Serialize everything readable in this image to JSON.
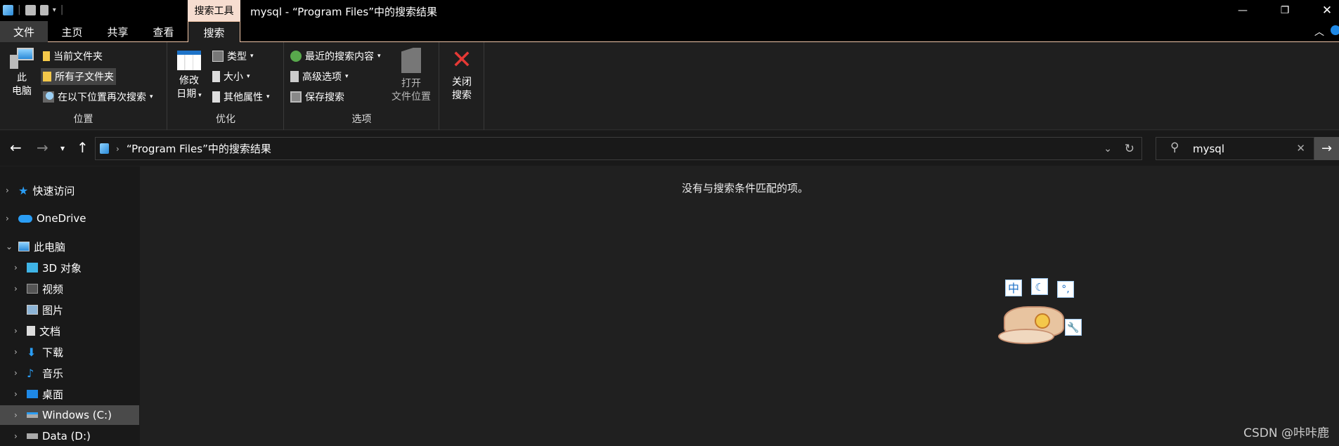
{
  "window": {
    "context_tab": "搜索工具",
    "title": "mysql - “Program Files”中的搜索结果"
  },
  "tabs": {
    "file": "文件",
    "home": "主页",
    "share": "共享",
    "view": "查看",
    "search": "搜索"
  },
  "ribbon": {
    "location": {
      "this_pc_line1": "此",
      "this_pc_line2": "电脑",
      "current_folder": "当前文件夹",
      "all_subfolders": "所有子文件夹",
      "search_again": "在以下位置再次搜索",
      "label": "位置"
    },
    "refine": {
      "date_line1": "修改",
      "date_line2": "日期",
      "kind": "类型",
      "size": "大小",
      "other_props": "其他属性",
      "label": "优化"
    },
    "options": {
      "recent": "最近的搜索内容",
      "advanced": "高级选项",
      "save": "保存搜索",
      "open_line1": "打开",
      "open_line2": "文件位置",
      "label": "选项"
    },
    "close": {
      "line1": "关闭",
      "line2": "搜索"
    }
  },
  "address": {
    "path": "“Program Files”中的搜索结果",
    "search_value": "mysql"
  },
  "nav": {
    "quick_access": "快速访问",
    "onedrive": "OneDrive",
    "this_pc": "此电脑",
    "items": [
      {
        "label": "3D 对象",
        "icon": "3d-objects-icon"
      },
      {
        "label": "视频",
        "icon": "video-icon"
      },
      {
        "label": "图片",
        "icon": "pictures-icon"
      },
      {
        "label": "文档",
        "icon": "documents-icon"
      },
      {
        "label": "下载",
        "icon": "downloads-icon"
      },
      {
        "label": "音乐",
        "icon": "music-icon"
      },
      {
        "label": "桌面",
        "icon": "desktop-icon"
      },
      {
        "label": "Windows (C:)",
        "icon": "drive-c-icon"
      },
      {
        "label": "Data (D:)",
        "icon": "drive-d-icon"
      }
    ]
  },
  "main": {
    "empty_message": "没有与搜索条件匹配的项。"
  },
  "ime": {
    "lang": "中"
  },
  "watermark": "CSDN @咔咔鹿"
}
